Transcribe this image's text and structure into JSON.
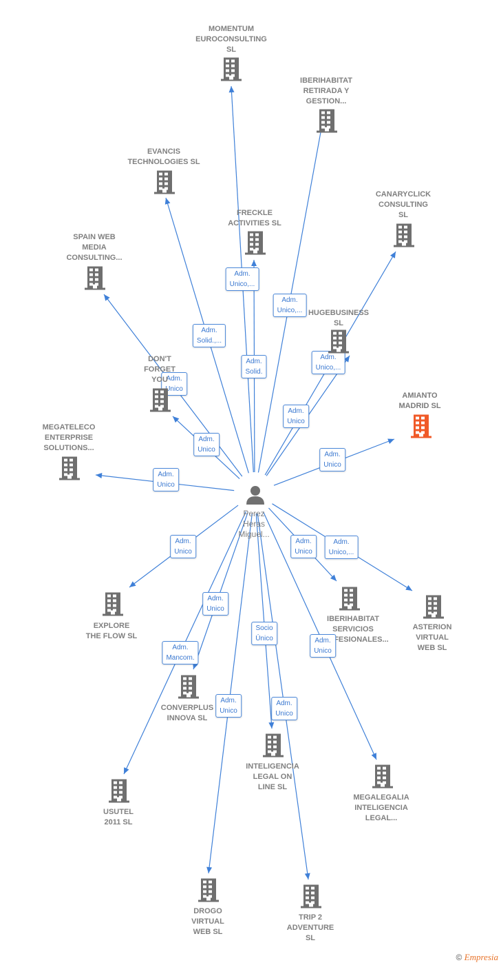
{
  "center": {
    "label": [
      "Perez",
      "Heras",
      "Miguel..."
    ],
    "icon": "person-icon"
  },
  "colors": {
    "edge": "#3f80d8",
    "company": "#6f6f6f",
    "highlight": "#f05a28",
    "label": "#808080"
  },
  "companies": [
    {
      "label": [
        "MOMENTUM",
        "EUROCONSULTING",
        "SL"
      ],
      "role": [
        "Adm.",
        "Unico,..."
      ]
    },
    {
      "label": [
        "IBERIHABITAT",
        "RETIRADA Y",
        "GESTION..."
      ],
      "role": [
        "Adm.",
        "Unico,..."
      ]
    },
    {
      "label": [
        "EVANCIS",
        "TECHNOLOGIES SL"
      ],
      "role": [
        "Adm.",
        "Solid.,..."
      ]
    },
    {
      "label": [
        "FRECKLE",
        "ACTIVITIES  SL"
      ],
      "role": [
        "Adm.",
        "Solid."
      ]
    },
    {
      "label": [
        "CANARYCLICK",
        "CONSULTING",
        "SL"
      ],
      "role": [
        "Adm.",
        "Unico,..."
      ]
    },
    {
      "label": [
        "SPAIN WEB",
        "MEDIA",
        "CONSULTING..."
      ],
      "role": [
        "Adm.",
        "Unico"
      ]
    },
    {
      "label": [
        "HUGEBUSINESS",
        "SL"
      ],
      "role": [
        "Adm.",
        "Unico"
      ]
    },
    {
      "label": [
        "DON'T",
        "FORGET",
        "YOU"
      ],
      "role": [
        "Adm.",
        "Unico"
      ]
    },
    {
      "label": [
        "AMIANTO",
        "MADRID  SL"
      ],
      "role": [
        "Adm.",
        "Unico"
      ],
      "highlight": true
    },
    {
      "label": [
        "MEGATELECO",
        "ENTERPRISE",
        "SOLUTIONS..."
      ],
      "role": [
        "Adm.",
        "Unico"
      ]
    },
    {
      "label": [
        "EXPLORE",
        "THE FLOW  SL"
      ],
      "role": [
        "Adm.",
        "Unico"
      ]
    },
    {
      "label": [
        "IBERIHABITAT",
        "SERVICIOS",
        "PROFESIONALES..."
      ],
      "role": [
        "Adm.",
        "Unico"
      ]
    },
    {
      "label": [
        "ASTERION",
        "VIRTUAL",
        "WEB  SL"
      ],
      "role": [
        "Adm.",
        "Unico,..."
      ]
    },
    {
      "label": [
        "CONVERPLUS",
        "INNOVA  SL"
      ],
      "role": [
        "Adm.",
        "Unico"
      ]
    },
    {
      "label": [
        "INTELIGENCIA",
        "LEGAL ON",
        "LINE  SL"
      ],
      "role": [
        "Socio",
        "Único"
      ]
    },
    {
      "label": [
        "MEGALEGALIA",
        "INTELIGENCIA",
        "LEGAL..."
      ],
      "role": [
        "Adm.",
        "Unico"
      ]
    },
    {
      "label": [
        "USUTEL",
        "2011 SL"
      ],
      "role": [
        "Adm.",
        "Mancom."
      ]
    },
    {
      "label": [
        "DROGO",
        "VIRTUAL",
        "WEB  SL"
      ],
      "role": [
        "Adm.",
        "Unico"
      ]
    },
    {
      "label": [
        "TRIP 2",
        "ADVENTURE",
        "SL"
      ],
      "role": [
        "Adm.",
        "Unico"
      ]
    }
  ],
  "footer": {
    "copyright": "©",
    "brand": "Empresia"
  }
}
